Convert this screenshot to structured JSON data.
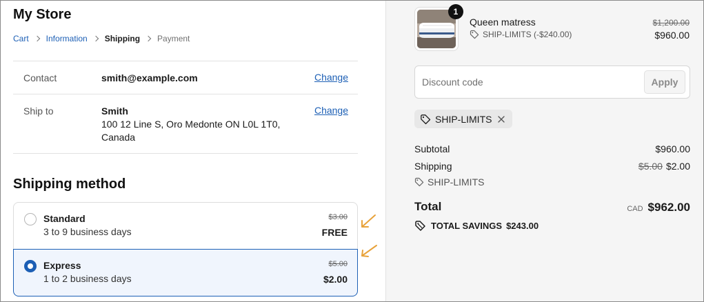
{
  "store": {
    "title": "My Store"
  },
  "breadcrumb": {
    "cart": "Cart",
    "information": "Information",
    "shipping": "Shipping",
    "payment": "Payment"
  },
  "summary": {
    "contact_label": "Contact",
    "contact_value": "smith@example.com",
    "ship_label": "Ship to",
    "ship_name": "Smith",
    "ship_address": "100 12 Line S, Oro Medonte ON L0L 1T0, Canada",
    "change_label": "Change"
  },
  "shipping_method": {
    "title": "Shipping method",
    "options": [
      {
        "name": "Standard",
        "desc": "3 to 9 business days",
        "old_price": "$3.00",
        "price": "FREE",
        "selected": false
      },
      {
        "name": "Express",
        "desc": "1 to 2 business days",
        "old_price": "$5.00",
        "price": "$2.00",
        "selected": true
      }
    ]
  },
  "cart": {
    "quantity_badge": "1",
    "product_name": "Queen matress",
    "product_discount": "SHIP-LIMITS (-$240.00)",
    "old_price": "$1,200.00",
    "price": "$960.00"
  },
  "discount": {
    "placeholder": "Discount code",
    "apply_label": "Apply",
    "applied_code": "SHIP-LIMITS"
  },
  "totals": {
    "subtotal_label": "Subtotal",
    "subtotal_value": "$960.00",
    "shipping_label": "Shipping",
    "shipping_old": "$5.00",
    "shipping_value": "$2.00",
    "shipping_code": "SHIP-LIMITS",
    "total_label": "Total",
    "currency": "CAD",
    "total_value": "$962.00",
    "savings_label": "TOTAL SAVINGS",
    "savings_value": "$243.00"
  },
  "colors": {
    "link": "#1c5fb5",
    "selected_border": "#1c5fb5",
    "selected_bg": "#f0f5fd",
    "annotation_arrow": "#e8a23a"
  }
}
